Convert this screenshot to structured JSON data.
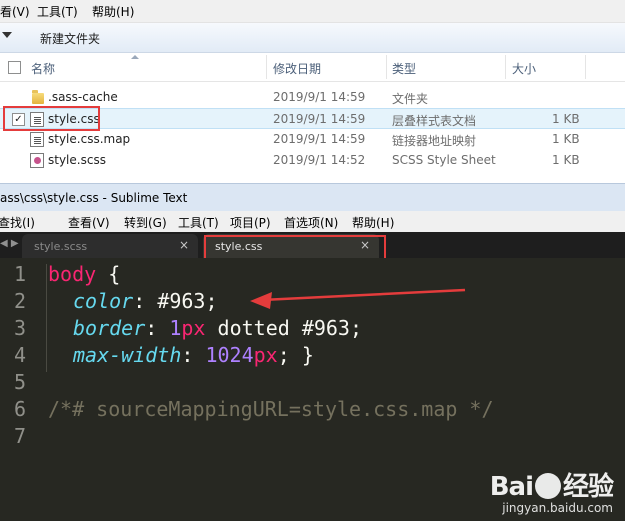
{
  "explorer": {
    "menu": [
      "看(V)",
      "工具(T)",
      "帮助(H)"
    ],
    "toolbar": {
      "new_folder": "新建文件夹"
    },
    "columns": {
      "name": "名称",
      "date": "修改日期",
      "type": "类型",
      "size": "大小"
    },
    "files": [
      {
        "name": ".sass-cache",
        "date": "2019/9/1 14:59",
        "type": "文件夹",
        "size": "",
        "icon": "folder-icon"
      },
      {
        "name": "style.css",
        "date": "2019/9/1 14:59",
        "type": "层叠样式表文档",
        "size": "1 KB",
        "icon": "css-file-icon",
        "selected": true,
        "checkbox": "✓"
      },
      {
        "name": "style.css.map",
        "date": "2019/9/1 14:59",
        "type": "链接器地址映射",
        "size": "1 KB",
        "icon": "map-file-icon"
      },
      {
        "name": "style.scss",
        "date": "2019/9/1 14:52",
        "type": "SCSS Style Sheet",
        "size": "1 KB",
        "icon": "scss-file-icon"
      }
    ]
  },
  "sublime": {
    "title": "ass\\css\\style.css - Sublime Text",
    "menu": [
      "查找(I)",
      "查看(V)",
      "转到(G)",
      "工具(T)",
      "项目(P)",
      "首选项(N)",
      "帮助(H)"
    ],
    "tab_arrows": "◀ ▶",
    "tabs": [
      {
        "label": "style.scss",
        "close": "×",
        "active": false
      },
      {
        "label": "style.css",
        "close": "×",
        "active": true
      }
    ],
    "line_numbers": [
      "1",
      "2",
      "3",
      "4",
      "5",
      "6",
      "7"
    ],
    "code": {
      "l1_selector": "body",
      "l1_brace": " {",
      "l2_prop": "color",
      "l2_colon": ": ",
      "l2_value": "#963",
      "l2_semi": ";",
      "l3_prop": "border",
      "l3_colon": ": ",
      "l3_num": "1",
      "l3_unit": "px",
      "l3_rest": " dotted #963;",
      "l4_prop": "max-width",
      "l4_colon": ": ",
      "l4_num": "1024",
      "l4_unit": "px",
      "l4_rest": "; }",
      "l6_comment": "/*# sourceMappingURL=style.css.map */"
    }
  },
  "watermark": {
    "brand_left": "Bai",
    "brand_right": "经验",
    "sub": "jingyan.baidu.com"
  },
  "colors": {
    "annotation_red": "#e43c3c",
    "editor_bg": "#272822",
    "keyword": "#f92672",
    "property": "#66d9ef",
    "number": "#ae81ff",
    "comment": "#75715e"
  }
}
